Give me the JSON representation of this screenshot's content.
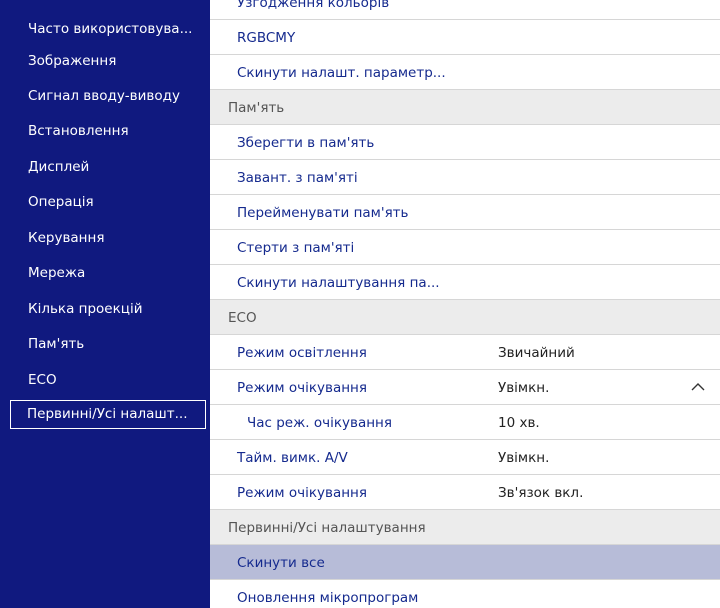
{
  "sidebar": {
    "items": [
      {
        "label": "Часто використовува..."
      },
      {
        "label": "Зображення"
      },
      {
        "label": "Сигнал вводу-виводу"
      },
      {
        "label": "Встановлення"
      },
      {
        "label": "Дисплей"
      },
      {
        "label": "Операція"
      },
      {
        "label": "Керування"
      },
      {
        "label": "Мережа"
      },
      {
        "label": "Кілька проекцій"
      },
      {
        "label": "Пам'ять"
      },
      {
        "label": "ECO"
      },
      {
        "label": "Первинні/Усі налашт..."
      }
    ],
    "selected_index": 11
  },
  "main": {
    "rows": [
      {
        "label": "Узгодження кольорів",
        "type": "item"
      },
      {
        "label": "RGBCMY",
        "type": "item"
      },
      {
        "label": "Скинути налашт. параметр...",
        "type": "item"
      },
      {
        "label": "Пам'ять",
        "type": "section"
      },
      {
        "label": "Зберегти в пам'ять",
        "type": "item"
      },
      {
        "label": "Завант. з пам'яті",
        "type": "item"
      },
      {
        "label": "Перейменувати пам'ять",
        "type": "item"
      },
      {
        "label": "Стерти з пам'яті",
        "type": "item"
      },
      {
        "label": "Скинути налаштування па...",
        "type": "item"
      },
      {
        "label": "ECO",
        "type": "section"
      },
      {
        "label": "Режим освітлення",
        "value": "Звичайний",
        "type": "item"
      },
      {
        "label": "Режим очікування",
        "value": "Увімкн.",
        "type": "item"
      },
      {
        "label": "Час реж. очікування",
        "value": "10 хв.",
        "type": "item"
      },
      {
        "label": "Тайм. вимк. A/V",
        "value": "Увімкн.",
        "type": "item"
      },
      {
        "label": "Режим очікування",
        "value": "Зв'язок вкл.",
        "type": "item"
      },
      {
        "label": "Первинні/Усі налаштування",
        "type": "section"
      },
      {
        "label": "Скинути все",
        "type": "item"
      },
      {
        "label": "Оновлення мікропрограм",
        "type": "item"
      }
    ],
    "highlighted_index": 16
  },
  "icons": {
    "collapse": "chevron-up-icon"
  },
  "colors": {
    "sidebar_bg": "#10197f",
    "item_text": "#152a8e",
    "highlight_bg": "#b7bcd8",
    "section_bg": "#ececec"
  }
}
